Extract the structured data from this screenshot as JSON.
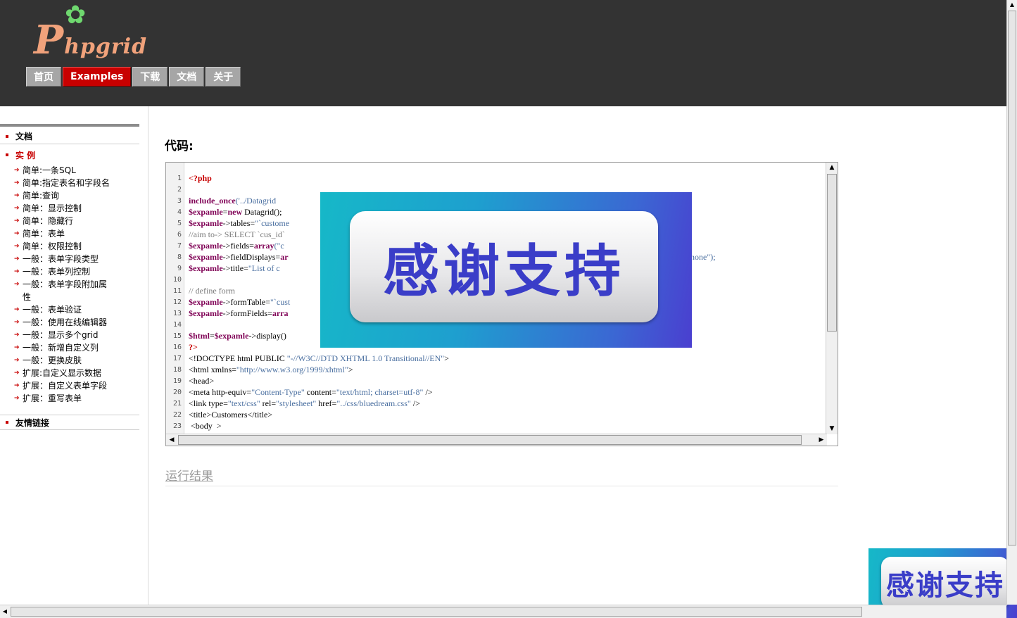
{
  "logo": {
    "flower": "✿",
    "big_letter": "P",
    "rest": "hpgrid"
  },
  "nav": [
    {
      "label": "首页",
      "active": false
    },
    {
      "label": "Examples",
      "active": true
    },
    {
      "label": "下载",
      "active": false
    },
    {
      "label": "文档",
      "active": false
    },
    {
      "label": "关于",
      "active": false
    }
  ],
  "sidebar": {
    "docs": "文档",
    "examples": "实 例",
    "items": [
      "简单:一条SQL",
      "简单:指定表名和字段名",
      "简单:查询",
      "简单：显示控制",
      "简单：隐藏行",
      "简单：表单",
      "简单：权限控制",
      "一般：表单字段类型",
      "一般：表单列控制",
      "一般：表单字段附加属性",
      "一般：表单验证",
      "一般：使用在线编辑器",
      "一般：显示多个grid",
      "一般：新增自定义列",
      "一般：更换皮肤",
      "扩展:自定义显示数据",
      "扩展：自定义表单字段",
      "扩展：重写表单"
    ],
    "links": "友情链接"
  },
  "main": {
    "code_title": "代码:",
    "result_title": "运行结果",
    "line_numbers": [
      "1",
      "2",
      "3",
      "4",
      "5",
      "6",
      "7",
      "8",
      "9",
      "10",
      "11",
      "12",
      "13",
      "14",
      "15",
      "16",
      "17",
      "18",
      "19",
      "20",
      "21",
      "22",
      "23"
    ]
  },
  "code": {
    "l1": "<?php",
    "l3a": "include_once",
    "l3b": "('../Datagrid",
    "l4a": "$expamle",
    "l4b": "=",
    "l4c": "new",
    "l4d": " Datagrid();",
    "l5a": "$expamle",
    "l5b": "->tables=",
    "l5c": "\"`custome",
    "l6": "//aim to-> SELECT `cus_id`",
    "l7a": "$expamle",
    "l7b": "->fields=",
    "l7c": "array",
    "l7d": "(\"c",
    "l8a": "$expamle",
    "l8b": "->fieldDisplays=",
    "l8c": "ar",
    "l8tail": "hone\");",
    "l9a": "$expamle",
    "l9b": "->title=",
    "l9c": "\"List of c",
    "l11": "// define form",
    "l12a": "$expamle",
    "l12b": "->formTable=",
    "l12c": "\"`cust",
    "l13a": "$expamle",
    "l13b": "->formFields=",
    "l13c": "arra",
    "l15a": "$html",
    "l15b": "=",
    "l15c": "$expamle",
    "l15d": "->display()",
    "l16": "?>",
    "l17a": "<!DOCTYPE html PUBLIC ",
    "l17b": "\"-//W3C//DTD XHTML 1.0 Transitional//EN\"",
    "l17c": ">",
    "l18a": "<html xmlns=",
    "l18b": "\"http://www.w3.org/1999/xhtml\"",
    "l18c": ">",
    "l19": "<head>",
    "l20a": "<meta http-equiv=",
    "l20b": "\"Content-Type\"",
    "l20c": " content=",
    "l20d": "\"text/html; charset=utf-8\"",
    "l20e": " />",
    "l21a": "<link type=",
    "l21b": "\"text/css\"",
    "l21c": " rel=",
    "l21d": "\"stylesheet\"",
    "l21e": " href=",
    "l21f": "\"../css/bluedream.css\"",
    "l21g": " />",
    "l22": "<title>Customers</title>",
    "l23": " <body  >"
  },
  "ads": {
    "center_text": "感谢支持",
    "corner_text": "感谢支持"
  },
  "scroll": {
    "up": "▲",
    "down": "▼",
    "left": "◀",
    "right": "▶"
  }
}
